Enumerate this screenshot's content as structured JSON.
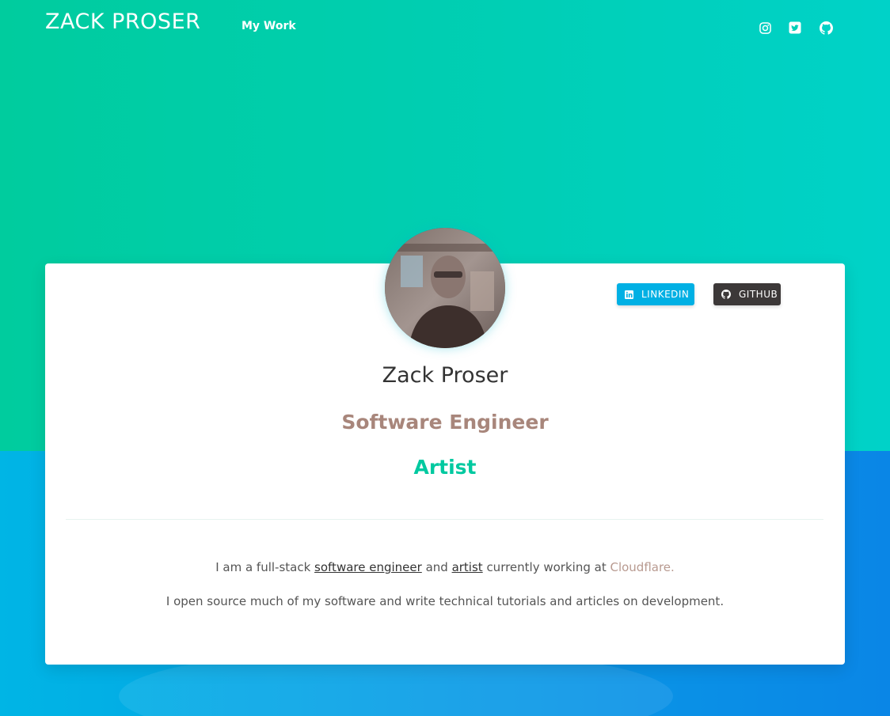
{
  "header": {
    "brand": "ZACK PROSER",
    "nav_link": "My Work",
    "social_icons": [
      "instagram-icon",
      "twitter-icon",
      "github-icon"
    ]
  },
  "profile": {
    "name": "Zack Proser",
    "roles": [
      "Software Engineer",
      "Artist"
    ],
    "buttons": {
      "linkedin": "LINKEDIN",
      "github": "GITHUB"
    }
  },
  "bio": {
    "line1": {
      "prefix": "I am a full-stack ",
      "link1": "software engineer",
      "middle": " and ",
      "link2": "artist",
      "suffix": " currently working at ",
      "link3": "Cloudflare."
    },
    "line2": "I open source much of my software and write technical tutorials and articles on development."
  },
  "colors": {
    "hero_green": "#00cc9e",
    "lower_blue": "#0a9ae6",
    "role_software": "#a8867b",
    "role_artist": "#00c9a0",
    "linkedin_button": "#00b0e4",
    "github_button": "#3c3838",
    "cloudflare_link": "#b89a90"
  }
}
